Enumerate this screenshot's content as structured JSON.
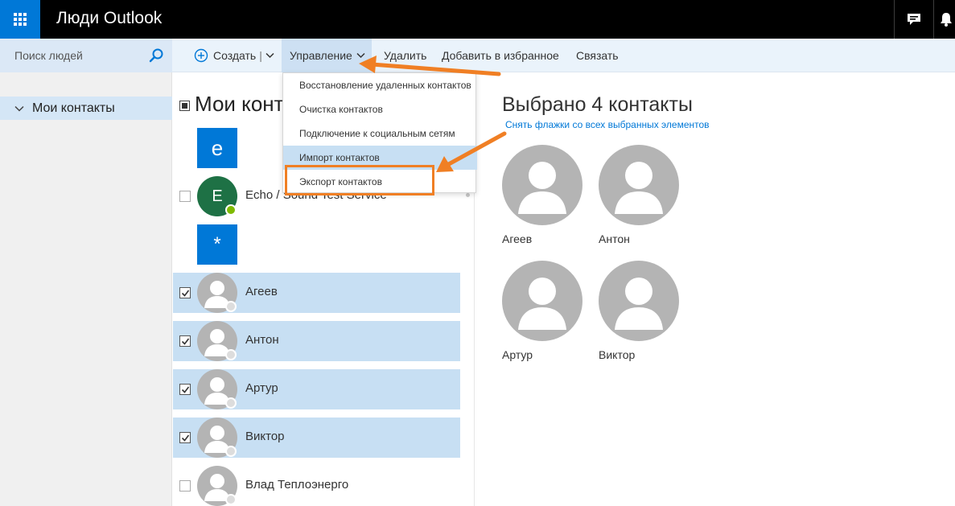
{
  "app": {
    "title": "Люди Outlook"
  },
  "search": {
    "placeholder": "Поиск людей"
  },
  "commands": {
    "create": "Создать",
    "manage": "Управление",
    "delete": "Удалить",
    "add_favorite": "Добавить в избранное",
    "link": "Связать"
  },
  "nav": {
    "my_contacts": "Мои контакты"
  },
  "list": {
    "title": "Мои конт",
    "contacts": [
      {
        "tile": "e",
        "name": "",
        "selected": false
      },
      {
        "tile": "E",
        "name": "Echo / Sound Test Service",
        "selected": false
      },
      {
        "tile": "*",
        "name": "",
        "selected": false
      },
      {
        "name": "Агеев",
        "selected": true
      },
      {
        "name": "Антон",
        "selected": true
      },
      {
        "name": "Артур",
        "selected": true
      },
      {
        "name": "Виктор",
        "selected": true
      },
      {
        "name": "Влад Теплоэнерго",
        "selected": false
      }
    ]
  },
  "manage_menu": {
    "items": [
      "Восстановление удаленных контактов",
      "Очистка контактов",
      "Подключение к социальным сетям",
      "Импорт контактов",
      "Экспорт контактов"
    ],
    "highlighted": "Импорт контактов"
  },
  "detail": {
    "title": "Выбрано 4 контакты",
    "clear_link": "Снять флажки со всех выбранных элементов",
    "cards": [
      "Агеев",
      "Антон",
      "Артур",
      "Виктор"
    ]
  },
  "colors": {
    "brand": "#0078d7",
    "annotation": "#f07f24",
    "selection": "#c7dff3"
  }
}
